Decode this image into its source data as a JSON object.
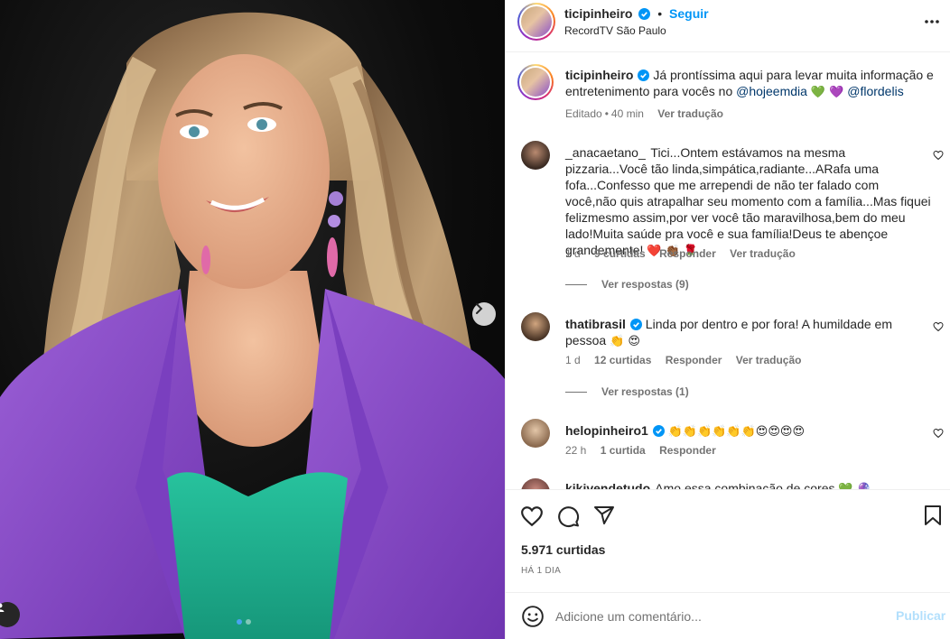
{
  "post": {
    "author": "ticipinheiro",
    "follow_label": "Seguir",
    "separator": "•",
    "location": "RecordTV São Paulo",
    "caption_text": "Já prontíssima aqui para levar muita informação e entretenimento para vocês no",
    "caption_mention1": "@hojeemdia",
    "caption_emojis": "💚 💜",
    "caption_mention2": "@flordelis",
    "caption_edited": "Editado",
    "caption_time": "40 min",
    "caption_translate": "Ver tradução"
  },
  "comments": [
    {
      "user": "_anacaetano_",
      "text": "Tici...Ontem estávamos na mesma pizzaria...Você tão linda,simpática,radiante...ARafa uma fofa...Confesso que me arrependi de não ter falado com você,não quis atrapalhar seu momento com a família...Mas fiquei felizmesmo assim,por ver você tão maravilhosa,bem do meu lado!Muita saúde pra você e sua família!Deus te abençoe grandemente!",
      "emojis": "❤️ 👏🏾 🌹",
      "time": "1 d",
      "likes": "9 curtidas",
      "reply": "Responder",
      "translate": "Ver tradução",
      "replies": "Ver respostas (9)"
    },
    {
      "user": "thatibrasil",
      "text": "Linda por dentro e por fora! A humildade em pessoa",
      "emojis": "👏 😍",
      "time": "1 d",
      "likes": "12 curtidas",
      "reply": "Responder",
      "translate": "Ver tradução",
      "replies": "Ver respostas (1)"
    },
    {
      "user": "helopinheiro1",
      "emojis": "👏👏👏👏👏👏😍😍😍😍",
      "time": "22 h",
      "likes": "1 curtida",
      "reply": "Responder"
    },
    {
      "user": "kikivendetudo",
      "text": "Amo essa combinação de cores",
      "emojis": "💚 🔮"
    }
  ],
  "footer": {
    "likes": "5.971 curtidas",
    "ago": "HÁ 1 DIA",
    "comment_placeholder": "Adicione um comentário...",
    "publish": "Publicar"
  },
  "carousel": {
    "slides": 2,
    "current": 1
  },
  "colors": {
    "accent": "#0095f6",
    "verified": "#0095f6",
    "text": "#262626",
    "muted": "#737373",
    "publish_disabled": "#b2dffc",
    "blazer": "#8a4fc8",
    "top": "#1fae8e"
  },
  "icons": [
    "verified-icon",
    "more-options-icon",
    "heart-icon",
    "comment-icon",
    "share-icon",
    "bookmark-icon",
    "emoji-icon",
    "chevron-right-icon",
    "user-tag-icon"
  ]
}
